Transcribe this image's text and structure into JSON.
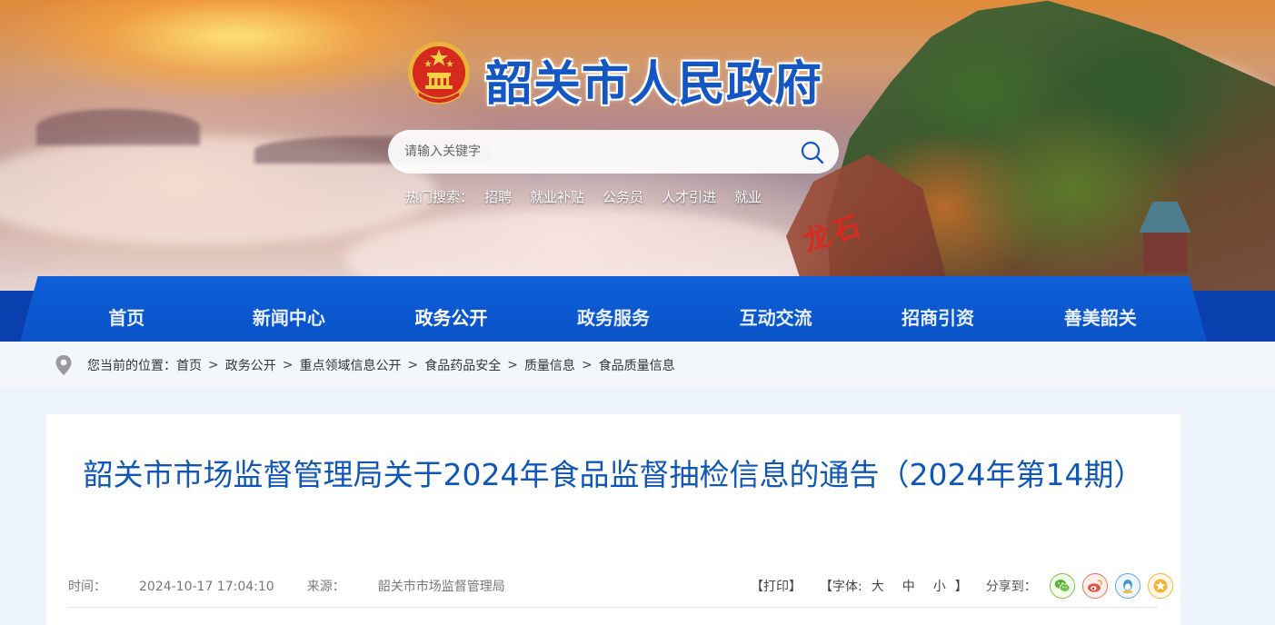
{
  "header": {
    "site_title": "韶关市人民政府",
    "rock_text": "龙石",
    "search": {
      "placeholder": "请输入关键字"
    },
    "hot_search": {
      "label": "热门搜索：",
      "keywords": [
        "招聘",
        "就业补贴",
        "公务员",
        "人才引进",
        "就业"
      ]
    }
  },
  "nav": {
    "items": [
      "首页",
      "新闻中心",
      "政务公开",
      "政务服务",
      "互动交流",
      "招商引资",
      "善美韶关"
    ],
    "active": "政务公开"
  },
  "breadcrumb": {
    "prefix": "您当前的位置：",
    "items": [
      "首页",
      "政务公开",
      "重点领域信息公开",
      "食品药品安全",
      "质量信息",
      "食品质量信息"
    ],
    "separator": ">"
  },
  "article": {
    "title": "韶关市市场监督管理局关于2024年食品监督抽检信息的通告（2024年第14期）",
    "time_label": "时间：",
    "time": "2024-10-17 17:04:10",
    "source_label": "来源：",
    "source": "韶关市市场监督管理局"
  },
  "tools": {
    "print": "【打印】",
    "font_prefix": "【字体:",
    "font_large": "大",
    "font_medium": "中",
    "font_small": "小",
    "font_suffix": "】",
    "share_label": "分享到：",
    "share_icons": [
      "wechat-icon",
      "weibo-icon",
      "qq-icon",
      "favorite-icon"
    ]
  },
  "colors": {
    "brand_blue": "#1457c2",
    "nav_blue": "#0a52c8",
    "title_blue": "#1057b6",
    "page_bg": "#eef4fb"
  }
}
